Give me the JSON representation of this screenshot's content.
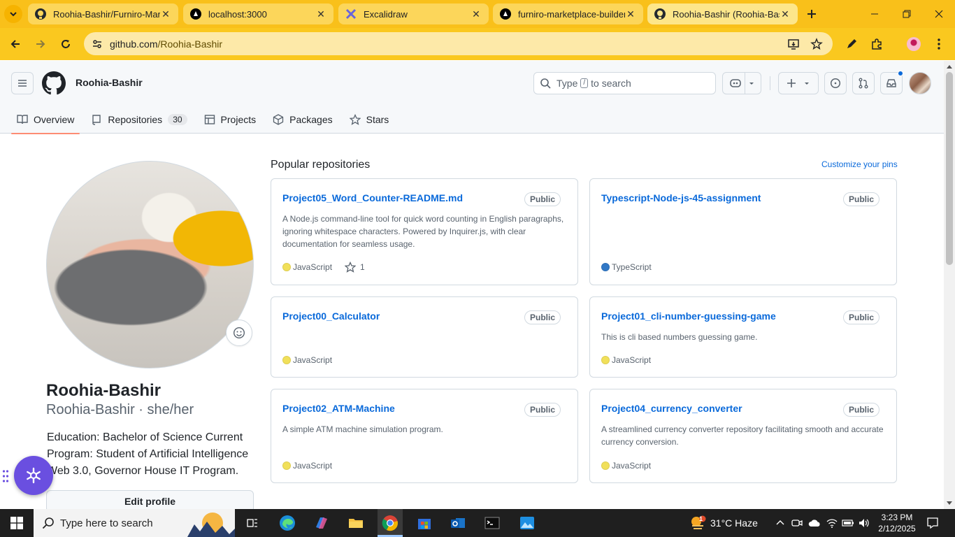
{
  "browser": {
    "tabs": [
      {
        "title": "Roohia-Bashir/Furniro-Marke",
        "icon": "github-icon"
      },
      {
        "title": "localhost:3000",
        "icon": "nextjs-icon"
      },
      {
        "title": "Excalidraw",
        "icon": "excalidraw-icon"
      },
      {
        "title": "furniro-marketplace-builder",
        "icon": "nextjs-icon"
      },
      {
        "title": "Roohia-Bashir (Roohia-Bashi",
        "icon": "github-icon"
      }
    ],
    "active_tab": 4,
    "url_host": "github.com",
    "url_path": "/Roohia-Bashir",
    "theme_color": "#f9c01a"
  },
  "header": {
    "username": "Roohia-Bashir",
    "search": {
      "before": "Type",
      "key": "/",
      "after": "to search"
    }
  },
  "nav": {
    "tabs": [
      {
        "label": "Overview",
        "icon": "book-icon"
      },
      {
        "label": "Repositories",
        "icon": "repo-icon",
        "count": "30"
      },
      {
        "label": "Projects",
        "icon": "table-icon"
      },
      {
        "label": "Packages",
        "icon": "package-icon"
      },
      {
        "label": "Stars",
        "icon": "star-icon"
      }
    ],
    "active": "Overview"
  },
  "profile": {
    "name": "Roohia-Bashir",
    "login_line": "Roohia-Bashir · she/her",
    "bio": "Education: Bachelor of Science Current Program: Student of Artificial Intelligence Web 3.0, Governor House IT Program.",
    "edit_label": "Edit profile"
  },
  "pinned": {
    "title": "Popular repositories",
    "customize": "Customize your pins",
    "repos": [
      {
        "name": "Project05_Word_Counter-README.md",
        "visibility": "Public",
        "description": "A Node.js command-line tool for quick word counting in English paragraphs, ignoring whitespace characters. Powered by Inquirer.js, with clear documentation for seamless usage.",
        "language": "JavaScript",
        "lang_color": "#f1e05a",
        "stars": "1"
      },
      {
        "name": "Typescript-Node-js-45-assignment",
        "visibility": "Public",
        "description": "",
        "language": "TypeScript",
        "lang_color": "#3178c6",
        "stars": ""
      },
      {
        "name": "Project00_Calculator",
        "visibility": "Public",
        "description": "",
        "language": "JavaScript",
        "lang_color": "#f1e05a",
        "stars": ""
      },
      {
        "name": "Project01_cli-number-guessing-game",
        "visibility": "Public",
        "description": "This is cli based numbers guessing game.",
        "language": "JavaScript",
        "lang_color": "#f1e05a",
        "stars": ""
      },
      {
        "name": "Project02_ATM-Machine",
        "visibility": "Public",
        "description": "A simple ATM machine simulation program.",
        "language": "JavaScript",
        "lang_color": "#f1e05a",
        "stars": ""
      },
      {
        "name": "Project04_currency_converter",
        "visibility": "Public",
        "description": "A streamlined currency converter repository facilitating smooth and accurate currency conversion.",
        "language": "JavaScript",
        "lang_color": "#f1e05a",
        "stars": ""
      }
    ]
  },
  "taskbar": {
    "search_placeholder": "Type here to search",
    "weather": "31°C  Haze",
    "weather_badge": "1",
    "time": "3:23 PM",
    "date": "2/12/2025"
  },
  "colors": {
    "link": "#0969da",
    "tab_underline": "#fd8c73",
    "widget": "#6a4fe0"
  }
}
